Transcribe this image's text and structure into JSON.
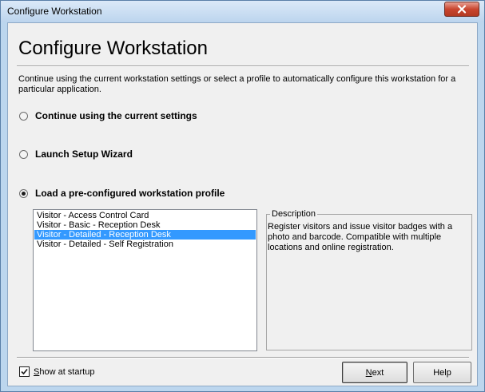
{
  "window": {
    "title": "Configure Workstation"
  },
  "header": {
    "heading": "Configure Workstation",
    "intro": "Continue using the current workstation settings or select a profile to automatically configure this workstation for a particular application."
  },
  "options": [
    {
      "label": "Continue using the current settings",
      "checked": false
    },
    {
      "label": "Launch Setup Wizard",
      "checked": false
    },
    {
      "label": "Load a pre-configured workstation profile",
      "checked": true
    }
  ],
  "profiles": {
    "items": [
      "Visitor - Access Control Card",
      "Visitor - Basic - Reception Desk",
      "Visitor - Detailed - Reception Desk",
      "Visitor - Detailed - Self Registration"
    ],
    "selected_index": 2
  },
  "description": {
    "legend": "Description",
    "text": "Register visitors and issue visitor badges with a photo and barcode. Compatible with multiple locations and online registration."
  },
  "footer": {
    "show_at_startup_mnemonic": "S",
    "show_at_startup_rest": "how at startup",
    "show_at_startup_checked": true,
    "next_mnemonic": "N",
    "next_rest": "ext",
    "help_label": "Help"
  },
  "colors": {
    "selection": "#3399ff",
    "client_bg": "#f0f0f0",
    "frame": "#bcd6ee",
    "close_button": "#c9452f"
  },
  "icons": {
    "close": "close-icon",
    "check": "checkmark-icon"
  }
}
